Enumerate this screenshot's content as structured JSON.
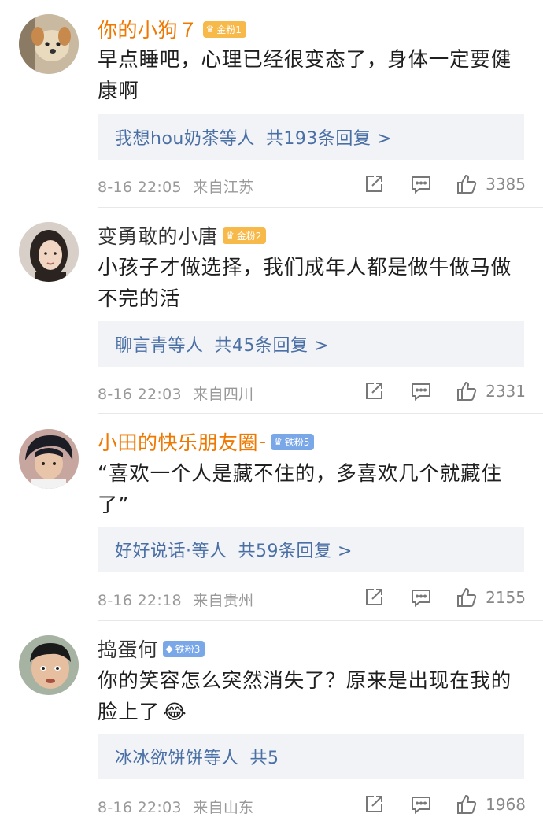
{
  "comments": [
    {
      "name": "你的小狗７",
      "name_color": "#ee7800",
      "badge": {
        "type": "gold",
        "label": "金粉1"
      },
      "text_line1": "早点睡吧，心理已经很变态了，身体一定要健",
      "text_line2": "康啊",
      "replies": {
        "who": "我想hou奶茶等人",
        "count": "共193条回复 >"
      },
      "time": "8-16 22:05",
      "location": "来自江苏",
      "likes": "3385",
      "avatar": "dog-avatar"
    },
    {
      "name": "变勇敢的小唐",
      "name_color": "#333333",
      "badge": {
        "type": "gold",
        "label": "金粉2"
      },
      "text_line1": "小孩子才做选择，我们成年人都是做牛做马做",
      "text_line2": "不完的活",
      "replies": {
        "who": "聊言青等人",
        "count": "共45条回复 >"
      },
      "time": "8-16 22:03",
      "location": "来自四川",
      "likes": "2331",
      "avatar": "girl-avatar"
    },
    {
      "name": "小田的快乐朋友圈",
      "name_suffix": "-",
      "name_color": "#ee7800",
      "badge": {
        "type": "iron",
        "label": "铁粉5"
      },
      "text_line1": "“喜欢一个人是藏不住的，多喜欢几个就藏住",
      "text_line2": "了”",
      "replies": {
        "who": "好好说话·等人",
        "count": "共59条回复 >"
      },
      "time": "8-16 22:18",
      "location": "来自贵州",
      "likes": "2155",
      "avatar": "anime-avatar"
    },
    {
      "name": "捣蛋何",
      "name_color": "#333333",
      "badge": {
        "type": "iron",
        "label": "铁粉3"
      },
      "text_line1": "你的笑容怎么突然消失了？原来是出现在我的",
      "text_line2": "脸上了",
      "emoji": "😂",
      "replies": {
        "who": "冰冰欲饼饼等人",
        "count": "共5"
      },
      "time": "8-16 22:03",
      "location": "来自山东",
      "likes": "1968",
      "avatar": "boy-avatar"
    }
  ]
}
